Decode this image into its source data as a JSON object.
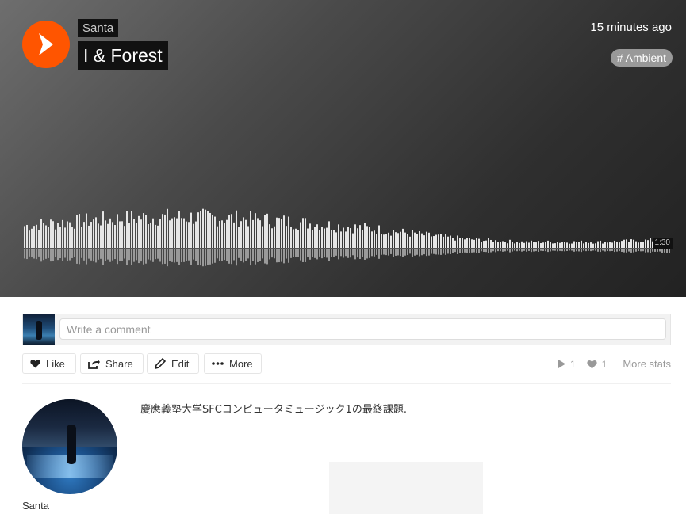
{
  "track": {
    "artist": "Santa",
    "title": "I & Forest",
    "posted": "15 minutes ago",
    "tag": "# Ambient",
    "duration": "1:30",
    "accent_color": "#ff5500"
  },
  "comment": {
    "placeholder": "Write a comment",
    "value": ""
  },
  "actions": {
    "like": "Like",
    "share": "Share",
    "edit": "Edit",
    "more": "More"
  },
  "stats": {
    "plays": "1",
    "likes": "1",
    "more_stats": "More stats"
  },
  "uploader": {
    "name": "Santa"
  },
  "description": "慶應義塾大学SFCコンピュータミュージック1の最終課題."
}
